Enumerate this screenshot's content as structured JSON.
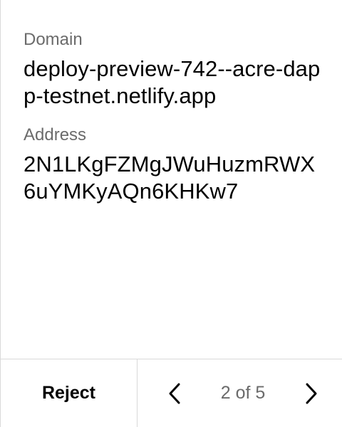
{
  "fields": [
    {
      "label": "Domain",
      "value": "deploy-preview-742--acre-dapp-testnet.netlify.app"
    },
    {
      "label": "Address",
      "value": "2N1LKgFZMgJWuHuzmRWX6uYMKyAQn6KHKw7"
    }
  ],
  "footer": {
    "reject_label": "Reject",
    "page_indicator": "2 of 5",
    "prev_icon": "chevron-left-icon",
    "next_icon": "chevron-right-icon"
  }
}
